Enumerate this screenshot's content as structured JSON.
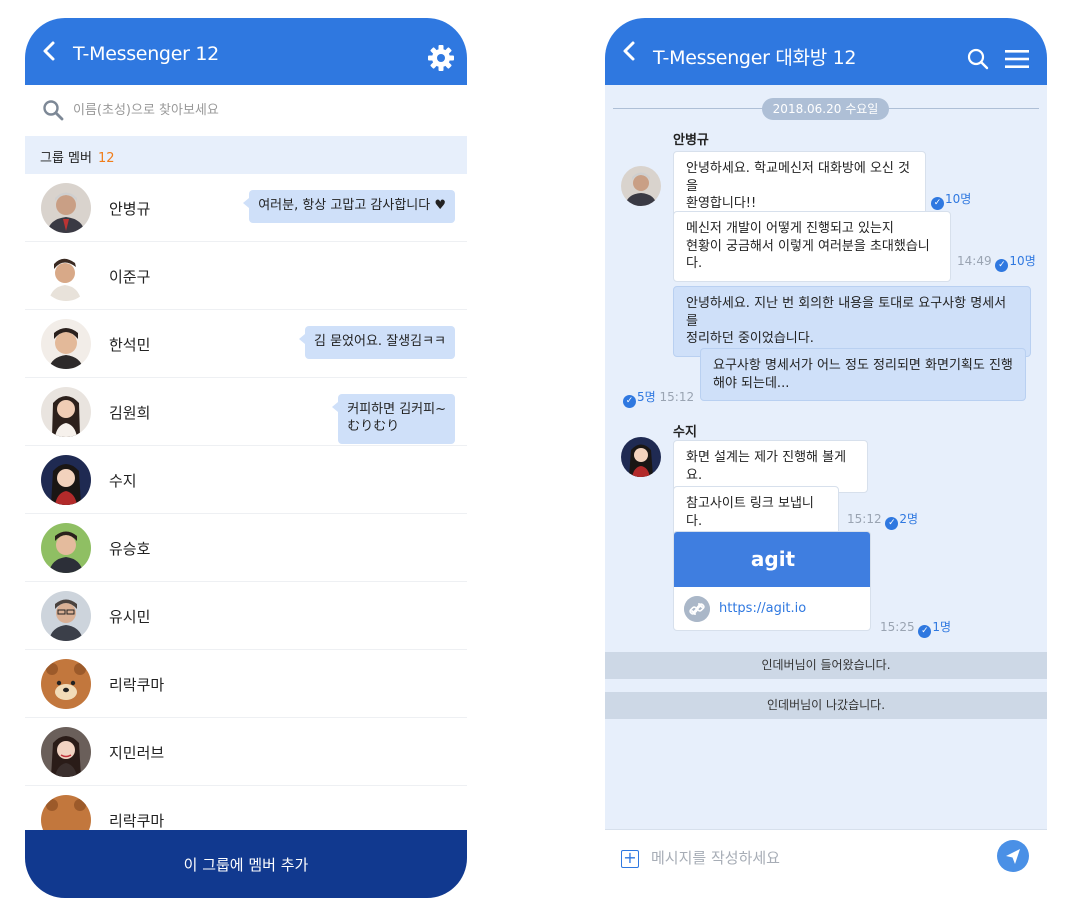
{
  "left": {
    "title": "T-Messenger 12",
    "search_placeholder": "이름(초성)으로 찾아보세요",
    "group_label": "그룹 멤버",
    "group_count": "12",
    "members": [
      {
        "name": "안병규",
        "bubble": "여러분, 항상 고맙고 감사합니다 ♥"
      },
      {
        "name": "이준구",
        "bubble": ""
      },
      {
        "name": "한석민",
        "bubble": "김 묻었어요. 잘생김ㅋㅋ"
      },
      {
        "name": "김원희",
        "bubble": "커피하면 김커피~\nむりむり"
      },
      {
        "name": "수지",
        "bubble": ""
      },
      {
        "name": "유승호",
        "bubble": ""
      },
      {
        "name": "유시민",
        "bubble": ""
      },
      {
        "name": "리락쿠마",
        "bubble": ""
      },
      {
        "name": "지민러브",
        "bubble": ""
      },
      {
        "name": "리락쿠마",
        "bubble": ""
      }
    ],
    "add_button": "이 그룹에 멤버 추가"
  },
  "right": {
    "title": "T-Messenger 대화방 12",
    "date": "2018.06.20  수요일",
    "sender1": "안병규",
    "msg1": "안녕하세요. 학교메신저 대화방에 오신 것을\n환영합니다!!",
    "msg1_read": "10명",
    "msg2": "메신저 개발이 어떻게 진행되고 있는지\n현황이 궁금해서 이렇게 여러분을 초대했습니다.",
    "msg2_time": "14:49",
    "msg2_read": "10명",
    "msg3": "안녕하세요. 지난 번 회의한 내용을 토대로 요구사항 명세서를\n정리하던 중이었습니다.",
    "msg4": "요구사항 명세서가 어느 정도 정리되면 화면기획도 진행\n해야 되는데...",
    "msg4_read": "5명",
    "msg4_time": "15:12",
    "sender2": "수지",
    "msg5": "화면 설계는 제가 진행해 볼게요.",
    "msg6": "참고사이트 링크 보냅니다.",
    "msg6_time": "15:12",
    "msg6_read": "2명",
    "link_title": "agit",
    "link_url": "https://agit.io",
    "link_time": "15:25",
    "link_read": "1명",
    "system1": "인데버님이 들어왔습니다.",
    "system2": "인데버님이 나갔습니다.",
    "input_placeholder": "메시지를 작성하세요"
  }
}
